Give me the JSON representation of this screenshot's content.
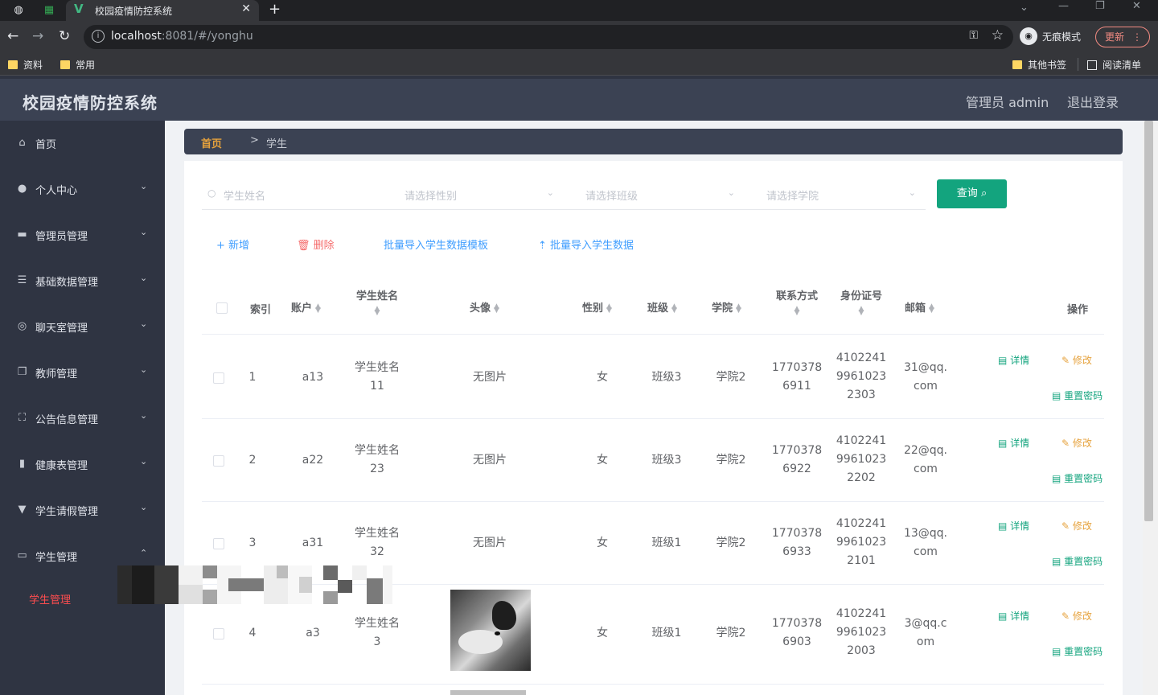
{
  "browser": {
    "tab_title": "校园疫情防控系统",
    "new_tab": "+",
    "url_host": "localhost",
    "url_rest": ":8081/#/yonghu",
    "incognito_label": "无痕模式",
    "update_label": "更新",
    "bookmarks": [
      "资料",
      "常用"
    ],
    "other_bookmarks": "其他书签",
    "reading_list": "阅读清单"
  },
  "header": {
    "title": "校园疫情防控系统",
    "admin": "管理员 admin",
    "logout": "退出登录"
  },
  "sidebar": {
    "items": [
      {
        "label": "首页",
        "icon": "home-icon"
      },
      {
        "label": "个人中心",
        "icon": "user-icon"
      },
      {
        "label": "管理员管理",
        "icon": "monitor-icon"
      },
      {
        "label": "基础数据管理",
        "icon": "list-icon"
      },
      {
        "label": "聊天室管理",
        "icon": "compass-icon"
      },
      {
        "label": "教师管理",
        "icon": "copy-icon"
      },
      {
        "label": "公告信息管理",
        "icon": "fullscreen-icon"
      },
      {
        "label": "健康表管理",
        "icon": "chart-icon"
      },
      {
        "label": "学生请假管理",
        "icon": "pin-icon"
      },
      {
        "label": "学生管理",
        "icon": "idcard-icon"
      }
    ],
    "active_sub": "学生管理"
  },
  "breadcrumb": {
    "home": "首页",
    "sep": ">",
    "current": "学生"
  },
  "filters": {
    "name_placeholder": "学生姓名",
    "gender_placeholder": "请选择性别",
    "class_placeholder": "请选择班级",
    "college_placeholder": "请选择学院",
    "query_label": "查询"
  },
  "actions": {
    "add": "新增",
    "delete": "删除",
    "template": "批量导入学生数据模板",
    "import": "批量导入学生数据"
  },
  "table": {
    "headers": {
      "index": "索引",
      "account": "账户",
      "name": "学生姓名",
      "avatar": "头像",
      "gender": "性别",
      "class": "班级",
      "college": "学院",
      "phone": "联系方式",
      "idcard": "身份证号",
      "email": "邮箱",
      "ops": "操作"
    },
    "op_labels": {
      "detail": "详情",
      "edit": "修改",
      "reset": "重置密码"
    },
    "rows": [
      {
        "index": "1",
        "account": "a13",
        "name1": "学生姓名",
        "name2": "11",
        "avatar": "无图片",
        "gender": "女",
        "class": "班级3",
        "college": "学院2",
        "phone1": "1770378",
        "phone2": "6911",
        "id1": "4102241",
        "id2": "9961023",
        "id3": "2303",
        "email1": "31@qq.",
        "email2": "com"
      },
      {
        "index": "2",
        "account": "a22",
        "name1": "学生姓名",
        "name2": "23",
        "avatar": "无图片",
        "gender": "女",
        "class": "班级3",
        "college": "学院2",
        "phone1": "1770378",
        "phone2": "6922",
        "id1": "4102241",
        "id2": "9961023",
        "id3": "2202",
        "email1": "22@qq.",
        "email2": "com"
      },
      {
        "index": "3",
        "account": "a31",
        "name1": "学生姓名",
        "name2": "32",
        "avatar": "无图片",
        "gender": "女",
        "class": "班级1",
        "college": "学院2",
        "phone1": "1770378",
        "phone2": "6933",
        "id1": "4102241",
        "id2": "9961023",
        "id3": "2101",
        "email1": "13@qq.",
        "email2": "com"
      },
      {
        "index": "4",
        "account": "a3",
        "name1": "学生姓名",
        "name2": "3",
        "avatar": "",
        "gender": "女",
        "class": "班级1",
        "college": "学院2",
        "phone1": "1770378",
        "phone2": "6903",
        "id1": "4102241",
        "id2": "9961023",
        "id3": "2003",
        "email1": "3@qq.c",
        "email2": "om"
      }
    ]
  }
}
